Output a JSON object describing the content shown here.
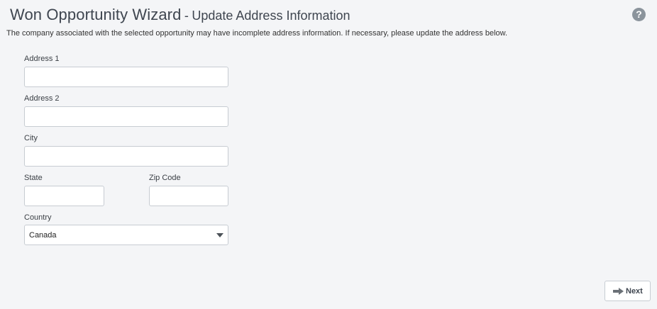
{
  "header": {
    "title": "Won Opportunity Wizard",
    "separator": "-",
    "subtitle": "Update Address Information",
    "help_icon": "question-circle-icon",
    "help_glyph": "?"
  },
  "description": "The company associated with the selected opportunity may have incomplete address information. If necessary, please update the address below.",
  "form": {
    "address1": {
      "label": "Address 1",
      "value": ""
    },
    "address2": {
      "label": "Address 2",
      "value": ""
    },
    "city": {
      "label": "City",
      "value": ""
    },
    "state": {
      "label": "State",
      "value": ""
    },
    "zip": {
      "label": "Zip Code",
      "value": ""
    },
    "country": {
      "label": "Country",
      "value": "Canada",
      "icon": "chevron-down-icon"
    }
  },
  "footer": {
    "next_label": "Next",
    "next_icon": "arrow-right-icon"
  },
  "colors": {
    "background": "#f4f5f7",
    "title": "#3f4650",
    "border": "#c7ccd2",
    "help": "#8b949c"
  }
}
